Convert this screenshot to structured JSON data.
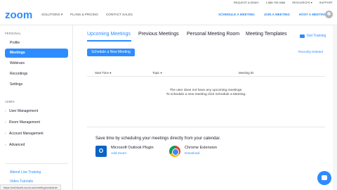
{
  "topbar": {
    "items": [
      "REQUEST A DEMO",
      "1.888.799.9666",
      "RESOURCES ▾",
      "SUPPORT"
    ]
  },
  "header": {
    "logo": "zoom",
    "nav_left": [
      "SOLUTIONS ▾",
      "PLANS & PRICING",
      "CONTACT SALES"
    ],
    "nav_right": [
      "SCHEDULE A MEETING",
      "JOIN A MEETING",
      "HOST A MEETING ▾"
    ]
  },
  "sidebar": {
    "section_personal": "PERSONAL",
    "items": [
      {
        "label": "Profile"
      },
      {
        "label": "Meetings"
      },
      {
        "label": "Webinars"
      },
      {
        "label": "Recordings"
      },
      {
        "label": "Settings"
      }
    ],
    "section_admin": "ADMIN",
    "groups": [
      {
        "label": "User Management"
      },
      {
        "label": "Room Management"
      },
      {
        "label": "Account Management"
      },
      {
        "label": "Advanced"
      }
    ],
    "links": [
      "Attend Live Training",
      "Video Tutorials"
    ]
  },
  "main": {
    "tabs": [
      "Upcoming Meetings",
      "Previous Meetings",
      "Personal Meeting Room",
      "Meeting Templates"
    ],
    "get_training": "Get Training",
    "schedule_button": "Schedule a New Meeting",
    "recently_deleted": "Recently Deleted",
    "columns": [
      "Start Time ▾",
      "Topic ▾",
      "Meeting ID"
    ],
    "empty_line1": "The user does not have any upcoming meetings.",
    "empty_line2": "To schedule a new meeting click Schedule a Meeting.",
    "calendar_title": "Save time by scheduling your meetings directly from your calendar.",
    "plugins": [
      {
        "name": "Microsoft Outlook Plugin",
        "link": "Add Zoom",
        "icon": "outlook-icon"
      },
      {
        "name": "Chrome Extension",
        "link": "Download",
        "icon": "chrome-icon"
      }
    ]
  },
  "status_url": "https://us04web.zoom.us/meeting/schedule",
  "colors": {
    "accent": "#2d8cff",
    "text": "#232333",
    "muted": "#747487"
  }
}
